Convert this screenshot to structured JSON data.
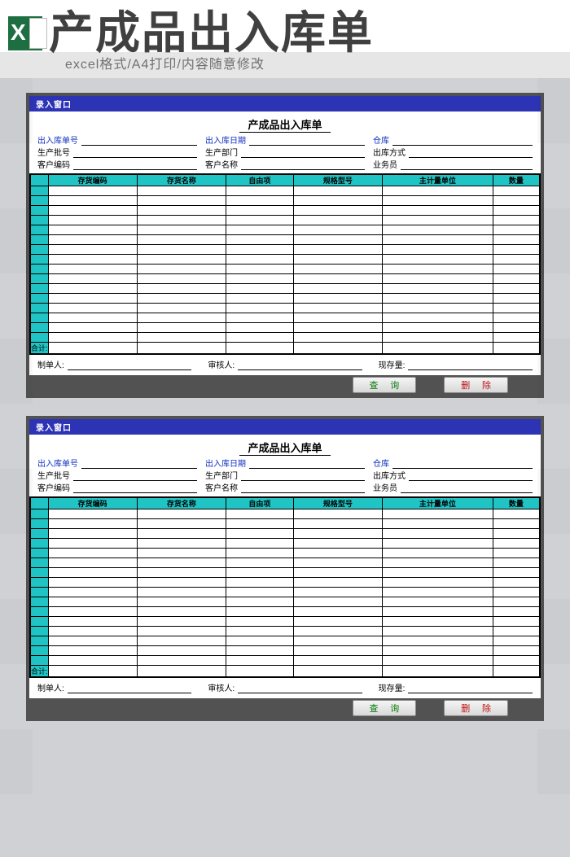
{
  "banner": {
    "excel_x": "X",
    "title": "产成品出入库单",
    "subtitle": "excel格式/A4打印/内容随意修改"
  },
  "form": {
    "window_title": "录入窗口",
    "title": "产成品出入库单",
    "header_fields": [
      {
        "label": "出入库单号",
        "blue": true
      },
      {
        "label": "出入库日期",
        "blue": true
      },
      {
        "label": "仓库",
        "blue": true
      },
      {
        "label": "生产批号",
        "blue": false
      },
      {
        "label": "生产部门",
        "blue": false
      },
      {
        "label": "出库方式",
        "blue": false
      },
      {
        "label": "客户编码",
        "blue": false
      },
      {
        "label": "客户名称",
        "blue": false
      },
      {
        "label": "业务员",
        "blue": false
      }
    ],
    "columns": [
      "存货编码",
      "存货名称",
      "自由项",
      "规格型号",
      "主计量单位",
      "数量"
    ],
    "body_rows": 16,
    "total_label": "合计:",
    "footer_fields": [
      "制单人:",
      "审核人:",
      "现存量:"
    ],
    "buttons": {
      "query": "查 询",
      "delete": "删 除"
    }
  }
}
